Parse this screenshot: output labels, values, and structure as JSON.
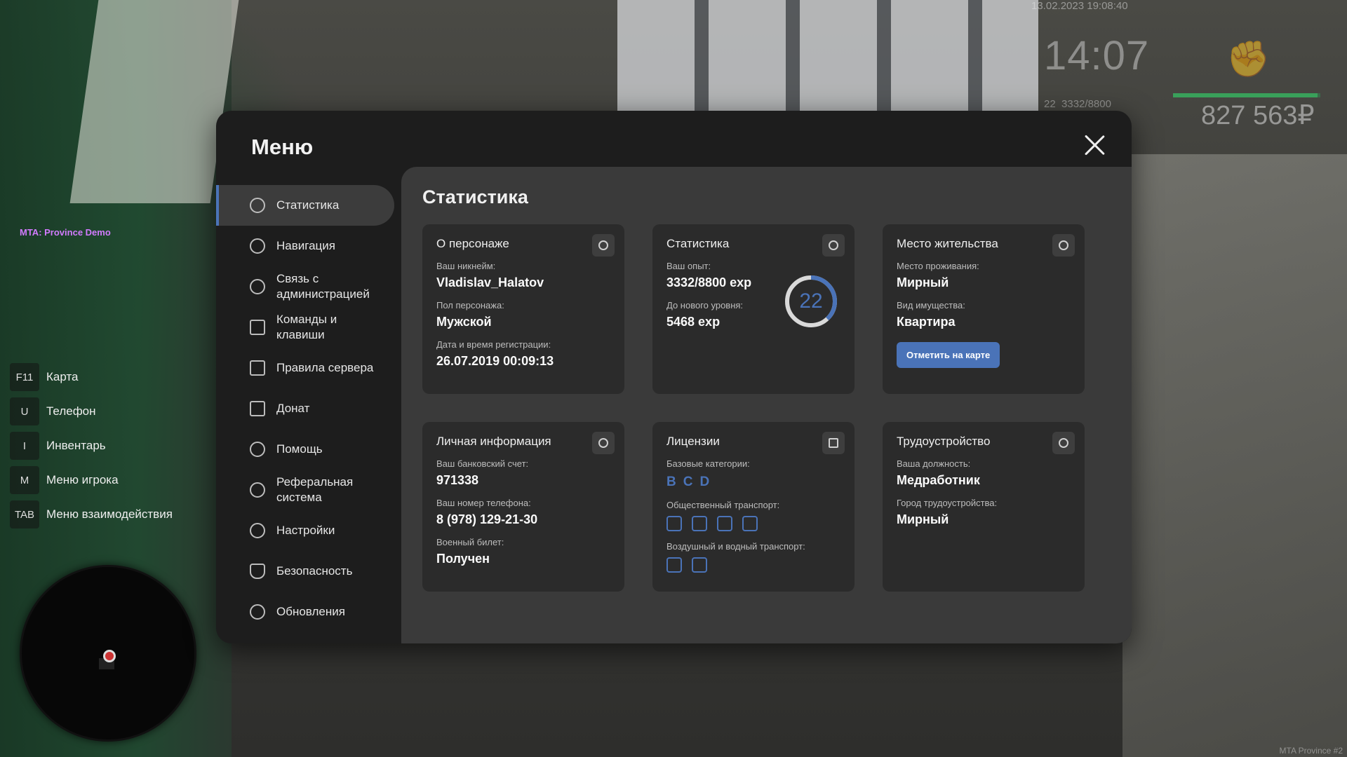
{
  "hud": {
    "date": "13.02.2023 19:08:40",
    "time": "14:07",
    "level": "22",
    "exp": "3332/8800",
    "money": "827 563₽",
    "health_fraction": 0.98
  },
  "server_label": "MTA: Province Demo",
  "corner_tag": "MTA Province #2",
  "hotkeys": [
    {
      "key": "F11",
      "label": "Карта"
    },
    {
      "key": "U",
      "label": "Телефон"
    },
    {
      "key": "I",
      "label": "Инвентарь"
    },
    {
      "key": "M",
      "label": "Меню игрока"
    },
    {
      "key": "TAB",
      "label": "Меню взаимодействия"
    }
  ],
  "menu": {
    "title": "Меню",
    "nav": [
      {
        "label": "Статистика",
        "icon": "chart-pie-icon"
      },
      {
        "label": "Навигация",
        "icon": "compass-icon"
      },
      {
        "label": "Связь с администрацией",
        "icon": "headset-icon"
      },
      {
        "label": "Команды и клавиши",
        "icon": "list-icon"
      },
      {
        "label": "Правила сервера",
        "icon": "scales-icon"
      },
      {
        "label": "Донат",
        "icon": "wallet-icon"
      },
      {
        "label": "Помощь",
        "icon": "handshake-icon"
      },
      {
        "label": "Реферальная система",
        "icon": "referral-icon"
      },
      {
        "label": "Настройки",
        "icon": "gear-icon"
      },
      {
        "label": "Безопасность",
        "icon": "shield-icon"
      },
      {
        "label": "Обновления",
        "icon": "refresh-icon"
      }
    ]
  },
  "stats": {
    "title": "Статистика",
    "character": {
      "title": "О персонаже",
      "nick_label": "Ваш никнейм:",
      "nick": "Vladislav_Halatov",
      "gender_label": "Пол персонажа:",
      "gender": "Мужской",
      "reg_label": "Дата и время регистрации:",
      "reg": "26.07.2019 00:09:13"
    },
    "statistics": {
      "title": "Статистика",
      "exp_label": "Ваш опыт:",
      "exp": "3332/8800 exp",
      "next_label": "До нового уровня:",
      "next": "5468 exp",
      "level": "22",
      "progress": 0.38
    },
    "residence": {
      "title": "Место жительства",
      "place_label": "Место проживания:",
      "place": "Мирный",
      "type_label": "Вид имущества:",
      "type": "Квартира",
      "button": "Отметить на карте"
    },
    "personal": {
      "title": "Личная информация",
      "bank_label": "Ваш банковский счет:",
      "bank": "971338",
      "phone_label": "Ваш номер телефона:",
      "phone": "8 (978) 129-21-30",
      "military_label": "Военный билет:",
      "military": "Получен"
    },
    "licenses": {
      "title": "Лицензии",
      "base_label": "Базовые категории:",
      "categories": [
        "B",
        "C",
        "D"
      ],
      "public_label": "Общественный транспорт:",
      "air_label": "Воздушный и водный транспорт:"
    },
    "job": {
      "title": "Трудоустройство",
      "position_label": "Ваша должность:",
      "position": "Медработник",
      "city_label": "Город трудоустройства:",
      "city": "Мирный"
    }
  },
  "colors": {
    "accent": "#4a73b8"
  }
}
